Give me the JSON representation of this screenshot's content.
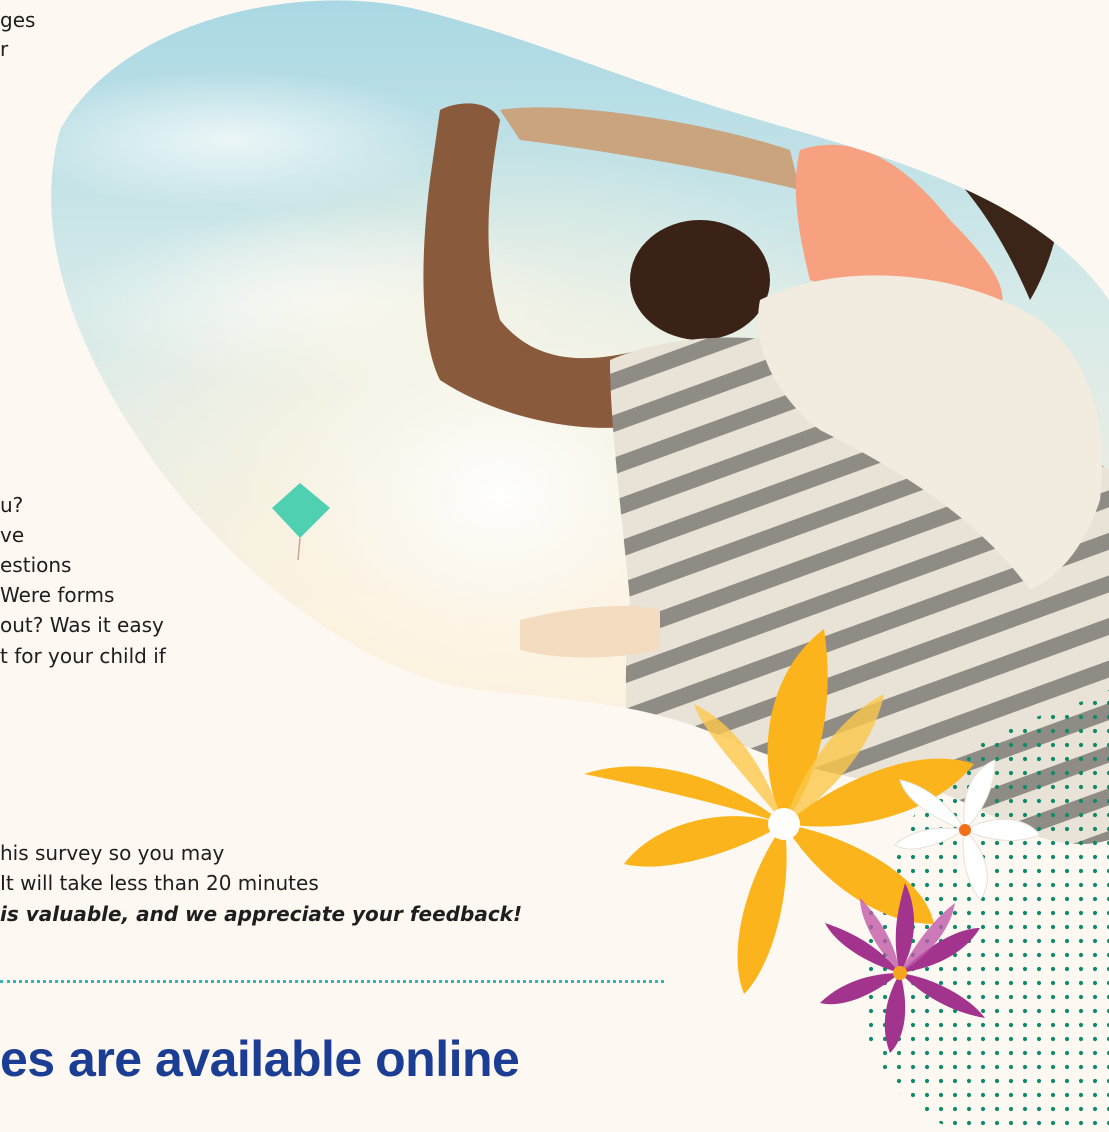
{
  "intro": {
    "line1": "ges",
    "line2": "r"
  },
  "questions": {
    "line1": "u?",
    "line2": "ve",
    "line3": "estions",
    "line4": "Were forms",
    "line5": "out? Was it easy",
    "line6": "t for your child if"
  },
  "survey": {
    "line1": "his survey so you may",
    "line2": "It will take less than 20 minutes",
    "line3": "is valuable, and we appreciate your feedback!"
  },
  "headline": "es are available online",
  "colors": {
    "background": "#fdf8f1",
    "headline": "#1b3d93",
    "rule": "#32b5b0",
    "yellow_flower": "#fbb41c",
    "purple_flower": "#a2348d",
    "white_flower": "#ffffff",
    "dots": "#0e8c6a"
  }
}
